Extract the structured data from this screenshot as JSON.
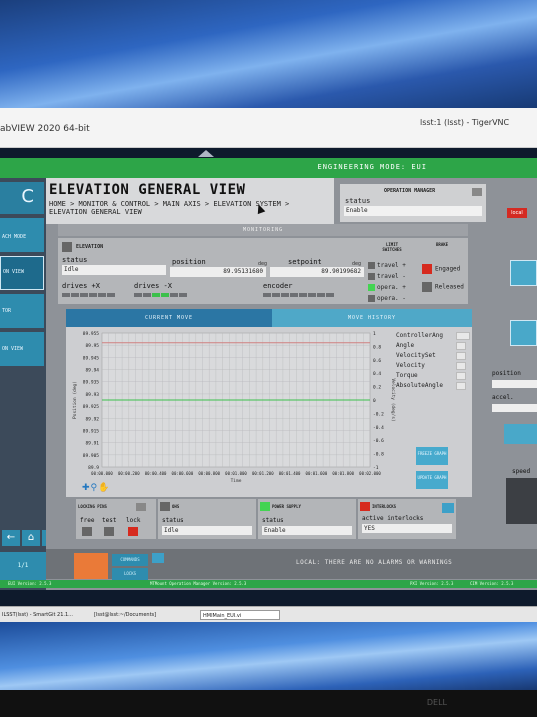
{
  "windows": {
    "labview_title": "abVIEW 2020 64-bit",
    "vnc_title": "lsst:1 (lsst) - TigerVNC"
  },
  "header_bar": {
    "mode": "ENGINEERING MODE: EUI"
  },
  "page": {
    "title": "ELEVATION GENERAL VIEW",
    "breadcrumb": "HOME > MONITOR & CONTROL > MAIN AXIS > ELEVATION SYSTEM > ELEVATION GENERAL VIEW"
  },
  "operation_manager": {
    "title": "OPERATION MANAGER",
    "status_label": "status",
    "status_value": "Enable"
  },
  "local_button": "local",
  "monitoring_label": "MONITORING",
  "left_nav": {
    "logo": "C",
    "items": [
      "ACH MODE",
      "ON VIEW",
      "TOR",
      "ON VIEW"
    ],
    "page_indicator": "1/1"
  },
  "elevation": {
    "name": "ELEVATION",
    "status_label": "status",
    "status_value": "Idle",
    "position_label": "position",
    "position_unit": "deg",
    "position_value": "89.95131680",
    "setpoint_label": "setpoint",
    "setpoint_unit": "deg",
    "setpoint_value": "89.90199682",
    "drives_pos_label": "drives +X",
    "drives_neg_label": "drives -X",
    "encoder_label": "encoder"
  },
  "limit_switches": {
    "title": "LIMIT SWITCHES",
    "items": [
      "travel +",
      "travel -",
      "opera. +",
      "opera. -"
    ]
  },
  "brake": {
    "title": "BRAKE",
    "engaged_label": "Engaged",
    "released_label": "Released",
    "colors": {
      "engaged": "#d62a1e",
      "released": "#666666"
    }
  },
  "tabs": {
    "current": "CURRENT MOVE",
    "history": "MOVE HISTORY"
  },
  "chart_data": {
    "type": "line",
    "ylabel": "Position (deg)",
    "y2label": "Velocity (deg/s)",
    "xlabel": "Time",
    "yticks": [
      "89.955",
      "89.95",
      "89.945",
      "89.94",
      "89.935",
      "89.93",
      "89.925",
      "89.92",
      "89.915",
      "89.91",
      "89.905",
      "89.9"
    ],
    "ylim": [
      89.9,
      89.955
    ],
    "y2ticks": [
      "1",
      "0.8",
      "0.6",
      "0.4",
      "0.2",
      "0",
      "-0.2",
      "-0.4",
      "-0.6",
      "-0.8",
      "-1"
    ],
    "y2lim": [
      -1,
      1
    ],
    "xticks": [
      "00:00.000",
      "00:00.200",
      "00:00.400",
      "00:00.600",
      "00:00.800",
      "00:01.000",
      "00:01.200",
      "00:01.400",
      "00:01.600",
      "00:01.800",
      "00:02.000"
    ],
    "grid": true,
    "series": [
      {
        "name": "Angle",
        "color": "#d08080",
        "y_position": 89.951
      },
      {
        "name": "Velocity",
        "color": "#3cc04b",
        "y2_value": 0
      }
    ]
  },
  "chart_legend": [
    "ControllerAng",
    "Angle",
    "VelocitySet",
    "Velocity",
    "Torque",
    "AbsoluteAngle"
  ],
  "chart_buttons": {
    "freeze": "FREEZE GRAPH",
    "update": "UPDATE GRAPH"
  },
  "locking_pins": {
    "title": "LOCKING PINS",
    "labels": [
      "free",
      "test",
      "lock"
    ]
  },
  "ohs": {
    "title": "OHS",
    "status_label": "status",
    "status_value": "Idle"
  },
  "power_supply": {
    "title": "POWER SUPPLY",
    "status_label": "status",
    "status_value": "Enable"
  },
  "interlocks": {
    "title": "INTERLOCKS",
    "active_label": "active interlocks",
    "active_value": "YES"
  },
  "footer": {
    "btn1": "COMMANDS",
    "btn2": "LOCKS",
    "alarm_text": "LOCAL: THERE ARE NO ALARMS OR WARNINGS"
  },
  "version_bar": {
    "left": "EUI Version: 2.5.3",
    "mid": "MTMount Operation Manager Version: 2.5.3",
    "right1": "PXI Version: 2.5.3",
    "right2": "CIM Version: 2.5.3"
  },
  "right_panel": {
    "position_label": "position",
    "accel_label": "accel.",
    "speed_label": "speed"
  },
  "taskbar": {
    "items": [
      "ILSST(lsst) - SmartGit 21.1...",
      "[lsst@lsst:~/Documents]",
      "HMIMain_EUI.vi"
    ]
  }
}
